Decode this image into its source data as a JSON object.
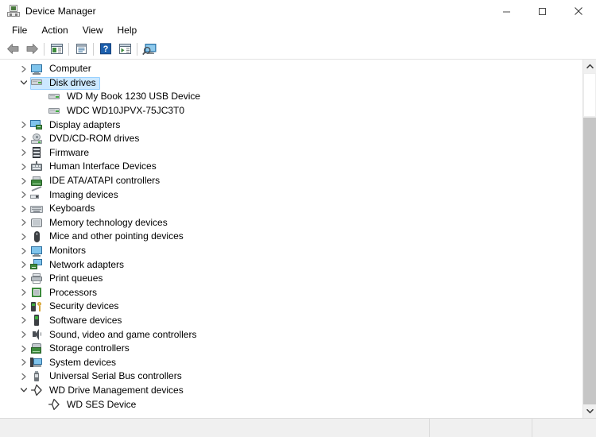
{
  "window": {
    "title": "Device Manager",
    "icon": "device-manager-icon",
    "controls": {
      "minimize": "minimize-icon",
      "maximize": "maximize-icon",
      "close": "close-icon"
    }
  },
  "menubar": {
    "items": [
      {
        "label": "File"
      },
      {
        "label": "Action"
      },
      {
        "label": "View"
      },
      {
        "label": "Help"
      }
    ]
  },
  "toolbar": {
    "buttons": [
      {
        "name": "back-button",
        "icon": "back-arrow-icon"
      },
      {
        "name": "forward-button",
        "icon": "forward-arrow-icon"
      },
      {
        "name": "show-hide-console-tree-button",
        "icon": "console-tree-icon"
      },
      {
        "name": "properties-button",
        "icon": "properties-icon"
      },
      {
        "name": "help-button",
        "icon": "help-question-icon"
      },
      {
        "name": "update-driver-button",
        "icon": "update-driver-icon"
      },
      {
        "name": "scan-for-hardware-changes-button",
        "icon": "scan-hardware-icon"
      }
    ]
  },
  "tree": {
    "nodes": [
      {
        "label": "Computer",
        "icon": "monitor-icon",
        "level": 0,
        "expanded": false,
        "hasChildren": true,
        "selected": false
      },
      {
        "label": "Disk drives",
        "icon": "disk-drive-icon",
        "level": 0,
        "expanded": true,
        "hasChildren": true,
        "selected": true
      },
      {
        "label": "WD My Book 1230 USB Device",
        "icon": "disk-drive-icon",
        "level": 1,
        "expanded": false,
        "hasChildren": false,
        "selected": false
      },
      {
        "label": "WDC WD10JPVX-75JC3T0",
        "icon": "disk-drive-icon",
        "level": 1,
        "expanded": false,
        "hasChildren": false,
        "selected": false
      },
      {
        "label": "Display adapters",
        "icon": "display-adapter-icon",
        "level": 0,
        "expanded": false,
        "hasChildren": true,
        "selected": false
      },
      {
        "label": "DVD/CD-ROM drives",
        "icon": "dvd-drive-icon",
        "level": 0,
        "expanded": false,
        "hasChildren": true,
        "selected": false
      },
      {
        "label": "Firmware",
        "icon": "firmware-icon",
        "level": 0,
        "expanded": false,
        "hasChildren": true,
        "selected": false
      },
      {
        "label": "Human Interface Devices",
        "icon": "hid-icon",
        "level": 0,
        "expanded": false,
        "hasChildren": true,
        "selected": false
      },
      {
        "label": "IDE ATA/ATAPI controllers",
        "icon": "ide-controller-icon",
        "level": 0,
        "expanded": false,
        "hasChildren": true,
        "selected": false
      },
      {
        "label": "Imaging devices",
        "icon": "imaging-device-icon",
        "level": 0,
        "expanded": false,
        "hasChildren": true,
        "selected": false
      },
      {
        "label": "Keyboards",
        "icon": "keyboard-icon",
        "level": 0,
        "expanded": false,
        "hasChildren": true,
        "selected": false
      },
      {
        "label": "Memory technology devices",
        "icon": "memory-technology-icon",
        "level": 0,
        "expanded": false,
        "hasChildren": true,
        "selected": false
      },
      {
        "label": "Mice and other pointing devices",
        "icon": "mouse-icon",
        "level": 0,
        "expanded": false,
        "hasChildren": true,
        "selected": false
      },
      {
        "label": "Monitors",
        "icon": "monitor-icon",
        "level": 0,
        "expanded": false,
        "hasChildren": true,
        "selected": false
      },
      {
        "label": "Network adapters",
        "icon": "network-adapter-icon",
        "level": 0,
        "expanded": false,
        "hasChildren": true,
        "selected": false
      },
      {
        "label": "Print queues",
        "icon": "printer-icon",
        "level": 0,
        "expanded": false,
        "hasChildren": true,
        "selected": false
      },
      {
        "label": "Processors",
        "icon": "processor-icon",
        "level": 0,
        "expanded": false,
        "hasChildren": true,
        "selected": false
      },
      {
        "label": "Security devices",
        "icon": "security-device-icon",
        "level": 0,
        "expanded": false,
        "hasChildren": true,
        "selected": false
      },
      {
        "label": "Software devices",
        "icon": "software-device-icon",
        "level": 0,
        "expanded": false,
        "hasChildren": true,
        "selected": false
      },
      {
        "label": "Sound, video and game controllers",
        "icon": "sound-controller-icon",
        "level": 0,
        "expanded": false,
        "hasChildren": true,
        "selected": false
      },
      {
        "label": "Storage controllers",
        "icon": "storage-controller-icon",
        "level": 0,
        "expanded": false,
        "hasChildren": true,
        "selected": false
      },
      {
        "label": "System devices",
        "icon": "system-device-icon",
        "level": 0,
        "expanded": false,
        "hasChildren": true,
        "selected": false
      },
      {
        "label": "Universal Serial Bus controllers",
        "icon": "usb-controller-icon",
        "level": 0,
        "expanded": false,
        "hasChildren": true,
        "selected": false
      },
      {
        "label": "WD Drive Management devices",
        "icon": "wd-device-icon",
        "level": 0,
        "expanded": true,
        "hasChildren": true,
        "selected": false
      },
      {
        "label": "WD SES Device",
        "icon": "wd-device-icon",
        "level": 1,
        "expanded": false,
        "hasChildren": false,
        "selected": false
      }
    ]
  },
  "scrollbar": {
    "up_arrow": "scroll-up-arrow-icon",
    "down_arrow": "scroll-down-arrow-icon"
  },
  "statusbar": {
    "segments": [
      "",
      "",
      ""
    ]
  },
  "colors": {
    "selection_fill": "#cce8ff",
    "selection_border": "#99d1ff",
    "chrome": "#f0f0f0",
    "text": "#000000",
    "accent_blue": "#4a9fd8",
    "accent_green": "#3d8b3d"
  }
}
